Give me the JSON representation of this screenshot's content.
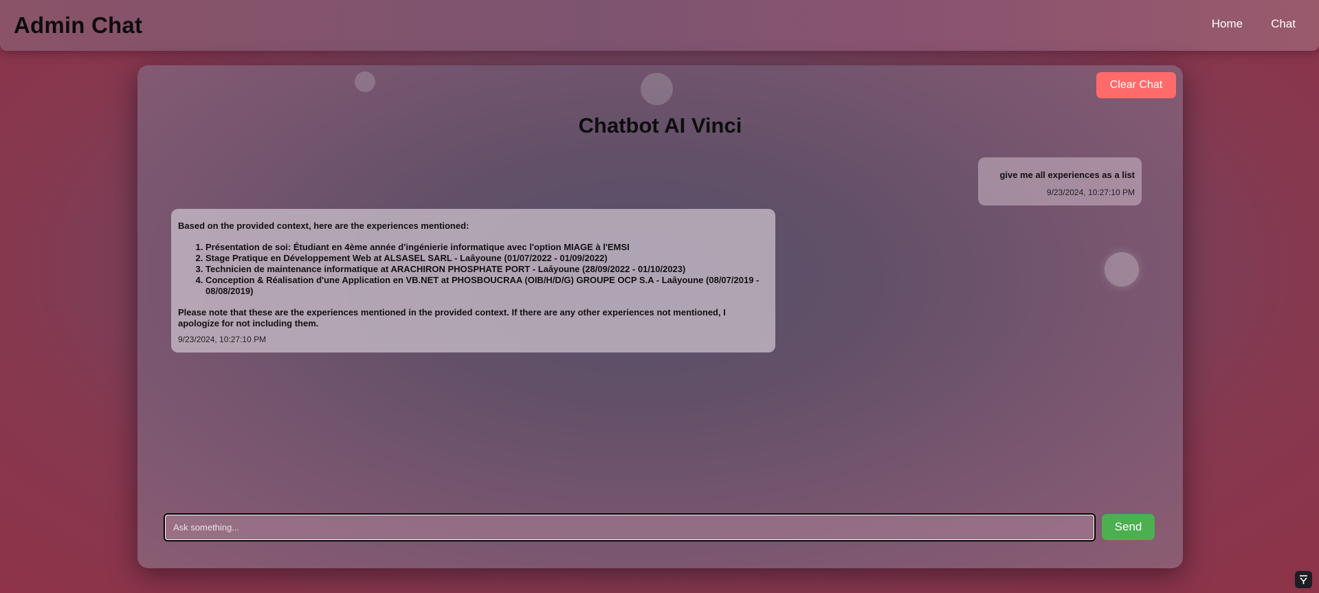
{
  "header": {
    "title": "Admin Chat",
    "nav": [
      "Home",
      "Chat"
    ]
  },
  "chat": {
    "title": "Chatbot AI Vinci",
    "clear_label": "Clear Chat",
    "messages": [
      {
        "role": "user",
        "text": "give me all experiences as a list",
        "time": "9/23/2024, 10:27:10 PM"
      },
      {
        "role": "bot",
        "intro": "Based on the provided context, here are the experiences mentioned:",
        "items": [
          "Présentation de soi: Étudiant en 4ème année d'ingénierie informatique avec l'option MIAGE à l'EMSI",
          "Stage Pratique en Développement Web at ALSASEL SARL - Laâyoune (01/07/2022 - 01/09/2022)",
          "Technicien de maintenance informatique at ARACHIRON PHOSPHATE PORT - Laâyoune (28/09/2022 - 01/10/2023)",
          "Conception & Réalisation d'une Application en VB.NET at PHOSBOUCRAA (OIB/H/D/G) GROUPE OCP S.A - Laâyoune (08/07/2019 - 08/08/2019)"
        ],
        "outro": "Please note that these are the experiences mentioned in the provided context. If there are any other experiences not mentioned, I apologize for not including them.",
        "time": "9/23/2024, 10:27:10 PM"
      }
    ],
    "input": {
      "placeholder": "Ask something...",
      "value": ""
    },
    "send_label": "Send"
  },
  "colors": {
    "clear_button": "#ff6b6b",
    "send_button": "#4caf50"
  },
  "icons": {
    "corner": "collapse-arrow-icon"
  }
}
